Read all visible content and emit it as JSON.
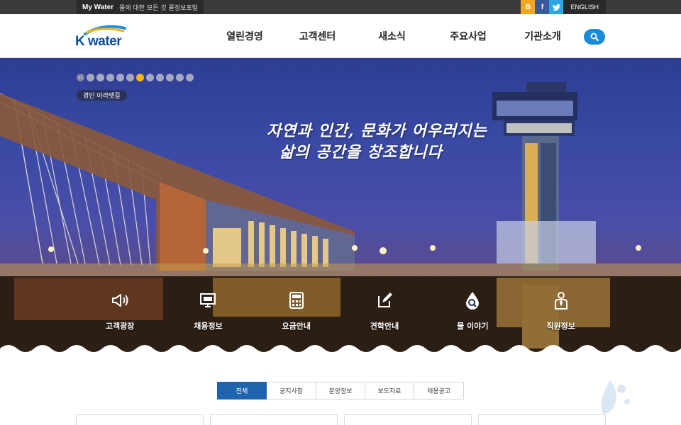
{
  "topbar": {
    "mywater_brand": "My Water",
    "mywater_tagline": "물에 대한 모든 것 물정보포털",
    "social": [
      {
        "icon": "blog-icon",
        "glyph": "B",
        "color": "#f5a623"
      },
      {
        "icon": "facebook-icon",
        "glyph": "f",
        "color": "#3b5998"
      },
      {
        "icon": "twitter-icon",
        "glyph": "t",
        "color": "#29a9e1"
      }
    ],
    "language": "ENGLISH"
  },
  "header": {
    "logo_text": "K water",
    "nav": [
      "열린경영",
      "고객센터",
      "새소식",
      "주요사업",
      "기관소개"
    ],
    "search_icon": "search-icon",
    "accent": "#1a8bd8"
  },
  "hero": {
    "slide_count": 10,
    "active_slide": 6,
    "place_tag": "경인 아라뱃길",
    "slogan_line1": "자연과 인간, 문화가 어우러지는",
    "slogan_line2": "삶의 공간을 창조합니다",
    "quick_links": [
      {
        "label": "고객광장",
        "icon": "megaphone-icon"
      },
      {
        "label": "채용정보",
        "icon": "monitor-icon"
      },
      {
        "label": "요금안내",
        "icon": "calculator-icon"
      },
      {
        "label": "견학안내",
        "icon": "pencil-note-icon"
      },
      {
        "label": "물 이야기",
        "icon": "water-drop-search-icon"
      },
      {
        "label": "직원정보",
        "icon": "person-tie-icon"
      }
    ]
  },
  "board": {
    "tabs": [
      "전체",
      "공지사항",
      "분양정보",
      "보도자료",
      "채용공고"
    ],
    "active_tab": 0,
    "active_color": "#1f65ae"
  }
}
